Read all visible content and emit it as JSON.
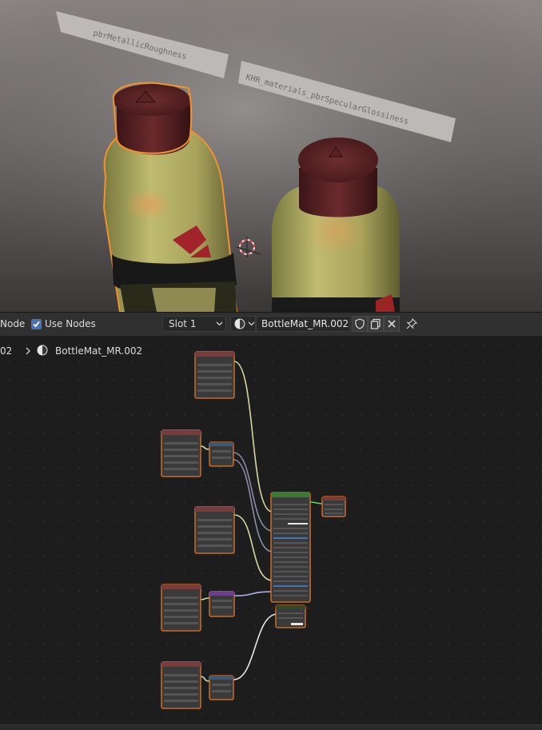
{
  "viewport": {
    "labels": [
      "pbrMetallicRoughness",
      "KHR_materials_pbrSpecularGlossiness"
    ]
  },
  "header": {
    "node_menu_label": "Node",
    "use_nodes_label": "Use Nodes",
    "use_nodes_checked": true,
    "slot_label": "Slot 1",
    "material_name": "BottleMat_MR.002"
  },
  "breadcrumb": {
    "parent_label": "02",
    "material_label": "BottleMat_MR.002"
  },
  "colors": {
    "accent": "#4772b3",
    "node_active_border": "#e2772a",
    "node_header_shader": "#3f7a34",
    "node_header_input": "#7a3b3b",
    "link_color": "#d6d6a6"
  },
  "node_editor": {
    "nodes": [
      {
        "name": "image-texture-node",
        "kind": "texture"
      },
      {
        "name": "image-texture-node",
        "kind": "texture"
      },
      {
        "name": "separate-rgb-node",
        "kind": "converter"
      },
      {
        "name": "image-texture-node",
        "kind": "texture"
      },
      {
        "name": "image-texture-node",
        "kind": "texture"
      },
      {
        "name": "normal-map-node",
        "kind": "vector"
      },
      {
        "name": "image-texture-node",
        "kind": "texture"
      },
      {
        "name": "math-node",
        "kind": "converter"
      },
      {
        "name": "principled-bsdf-node",
        "kind": "shader"
      },
      {
        "name": "material-output-node",
        "kind": "output"
      },
      {
        "name": "settings-node",
        "kind": "group"
      }
    ]
  }
}
